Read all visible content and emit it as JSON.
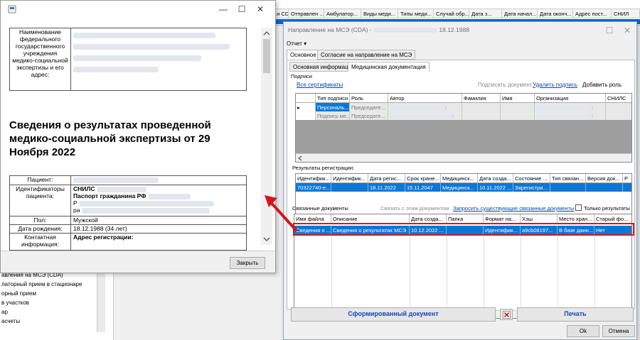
{
  "background": {
    "columns": [
      "...н CD...",
      "Отправлен ...",
      "Амбулатор...",
      "Виды меди...",
      "Типы меди...",
      "Случай обр...",
      "Дата з...",
      "Дата начал...",
      "Дата оконч...",
      "Адрес пост...",
      "СНИЛ"
    ],
    "left_list": [
      "авления на МСЭ (CDA)",
      "латорный прием в стационаре",
      "орный прием",
      "в участков",
      "ар",
      "асчеты"
    ]
  },
  "doc_window": {
    "controls": {
      "minimize": "—",
      "maximize": "☐",
      "close": "✕"
    },
    "org_label": "Наименование федерального государственного учреждения медико-социальной экспертизы и его адрес:",
    "heading": "Сведения о результатах проведенной медико-социальной экспертизы от 29 Ноября 2022",
    "rows": {
      "patient_label": "Пациент:",
      "ids_label": "Идентификаторы пациента:",
      "snils": "СНИЛС",
      "passport": "Паспорт гражданина РФ",
      "id_extra1": "Р",
      "id_extra2": "ра",
      "sex_label": "Пол:",
      "sex_value": "Мужской",
      "dob_label": "Дата рождения:",
      "dob_value": "18.12.1988 (34 лет)",
      "contact_label": "Контактная информация:",
      "address_label": "Адрес регистрации:"
    },
    "close_button": "Закрыть"
  },
  "form_window": {
    "title": "Направление на МСЭ (CDA) -",
    "title_date": "18.12.1988",
    "controls": {
      "maximize": "☐",
      "close": "✕"
    },
    "report_menu": "Отчет ▾",
    "tabs": [
      "Основное",
      "Согласие на направление на МСЭ"
    ],
    "subtabs": [
      "Основная информация",
      "Медицинская документация"
    ],
    "signatures": {
      "group_label": "Подписи",
      "all_certs": "Все сертификаты",
      "sign_doc": "Подписать документ",
      "delete_sig": "Удалить подпись",
      "add_role": "Добавить роль",
      "columns": [
        "",
        "Тип подписи",
        "Роль",
        "Автор",
        "Фамилия",
        "Имя",
        "Организация",
        "СНИЛС"
      ],
      "rows": [
        [
          "▸",
          "Персональ...",
          "Председате...",
          "",
          "",
          "",
          "",
          ""
        ],
        [
          "",
          "Подпись ме...",
          "Председате...",
          "",
          "",
          "",
          "",
          ""
        ]
      ]
    },
    "registration": {
      "label": "Результаты регистрации:",
      "columns": [
        "Идентифик...",
        "Идентифик...",
        "Дата регис...",
        "Срок хране...",
        "Медицинск...",
        "Дата созда...",
        "Состояние ...",
        "Тип связан...",
        "Версия док...",
        "Р"
      ],
      "row": [
        "70322740-е...",
        "",
        "18.11.2022",
        "15.11.2047",
        "Медицинск...",
        "10.11.2022 ...",
        "Зарегистри...",
        "",
        "",
        ""
      ]
    },
    "related": {
      "label": "Связанные документы",
      "link_doc": "Связать с этим документом",
      "request_link": "Запросить существующие связанные документы",
      "only_results": "Только результаты",
      "columns": [
        "Имя файла",
        "Описание",
        "Дата созда...",
        "Папка",
        "Формат на...",
        "Хэш",
        "Место хран...",
        "Старый фо..."
      ],
      "row": [
        "Сведения о ...",
        "Сведения о результатах МСЭ",
        "10.12.2022 ...",
        "",
        "Идентифик...",
        "a9cb08197...",
        "В базе данн...",
        "Нет"
      ]
    },
    "generated_doc_button": "Сформированный документ",
    "print_button": "Печать",
    "ok_button": "Ok",
    "cancel_button": "Отмена"
  },
  "colors": {
    "selection": "#0b78d7",
    "highlight_box": "#e0141e",
    "arrow": "#d4141e",
    "link": "#0645ad"
  }
}
